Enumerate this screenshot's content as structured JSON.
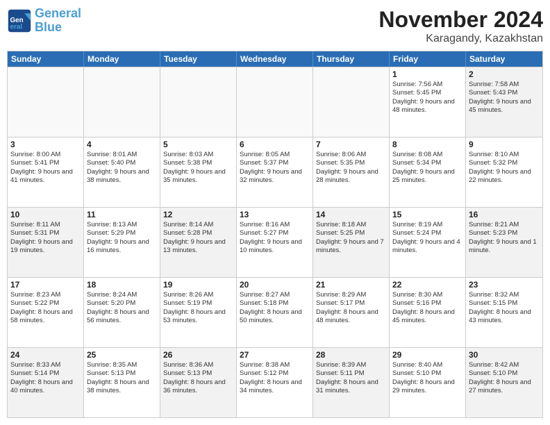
{
  "logo": {
    "line1": "General",
    "line2": "Blue"
  },
  "title": "November 2024",
  "subtitle": "Karagandy, Kazakhstan",
  "days": [
    "Sunday",
    "Monday",
    "Tuesday",
    "Wednesday",
    "Thursday",
    "Friday",
    "Saturday"
  ],
  "rows": [
    [
      {
        "day": "",
        "empty": true
      },
      {
        "day": "",
        "empty": true
      },
      {
        "day": "",
        "empty": true
      },
      {
        "day": "",
        "empty": true
      },
      {
        "day": "",
        "empty": true
      },
      {
        "day": "1",
        "sunrise": "7:56 AM",
        "sunset": "5:45 PM",
        "daylight": "9 hours and 48 minutes."
      },
      {
        "day": "2",
        "sunrise": "7:58 AM",
        "sunset": "5:43 PM",
        "daylight": "9 hours and 45 minutes."
      }
    ],
    [
      {
        "day": "3",
        "sunrise": "8:00 AM",
        "sunset": "5:41 PM",
        "daylight": "9 hours and 41 minutes."
      },
      {
        "day": "4",
        "sunrise": "8:01 AM",
        "sunset": "5:40 PM",
        "daylight": "9 hours and 38 minutes."
      },
      {
        "day": "5",
        "sunrise": "8:03 AM",
        "sunset": "5:38 PM",
        "daylight": "9 hours and 35 minutes."
      },
      {
        "day": "6",
        "sunrise": "8:05 AM",
        "sunset": "5:37 PM",
        "daylight": "9 hours and 32 minutes."
      },
      {
        "day": "7",
        "sunrise": "8:06 AM",
        "sunset": "5:35 PM",
        "daylight": "9 hours and 28 minutes."
      },
      {
        "day": "8",
        "sunrise": "8:08 AM",
        "sunset": "5:34 PM",
        "daylight": "9 hours and 25 minutes."
      },
      {
        "day": "9",
        "sunrise": "8:10 AM",
        "sunset": "5:32 PM",
        "daylight": "9 hours and 22 minutes."
      }
    ],
    [
      {
        "day": "10",
        "sunrise": "8:11 AM",
        "sunset": "5:31 PM",
        "daylight": "9 hours and 19 minutes."
      },
      {
        "day": "11",
        "sunrise": "8:13 AM",
        "sunset": "5:29 PM",
        "daylight": "9 hours and 16 minutes."
      },
      {
        "day": "12",
        "sunrise": "8:14 AM",
        "sunset": "5:28 PM",
        "daylight": "9 hours and 13 minutes."
      },
      {
        "day": "13",
        "sunrise": "8:16 AM",
        "sunset": "5:27 PM",
        "daylight": "9 hours and 10 minutes."
      },
      {
        "day": "14",
        "sunrise": "8:18 AM",
        "sunset": "5:25 PM",
        "daylight": "9 hours and 7 minutes."
      },
      {
        "day": "15",
        "sunrise": "8:19 AM",
        "sunset": "5:24 PM",
        "daylight": "9 hours and 4 minutes."
      },
      {
        "day": "16",
        "sunrise": "8:21 AM",
        "sunset": "5:23 PM",
        "daylight": "9 hours and 1 minute."
      }
    ],
    [
      {
        "day": "17",
        "sunrise": "8:23 AM",
        "sunset": "5:22 PM",
        "daylight": "8 hours and 58 minutes."
      },
      {
        "day": "18",
        "sunrise": "8:24 AM",
        "sunset": "5:20 PM",
        "daylight": "8 hours and 56 minutes."
      },
      {
        "day": "19",
        "sunrise": "8:26 AM",
        "sunset": "5:19 PM",
        "daylight": "8 hours and 53 minutes."
      },
      {
        "day": "20",
        "sunrise": "8:27 AM",
        "sunset": "5:18 PM",
        "daylight": "8 hours and 50 minutes."
      },
      {
        "day": "21",
        "sunrise": "8:29 AM",
        "sunset": "5:17 PM",
        "daylight": "8 hours and 48 minutes."
      },
      {
        "day": "22",
        "sunrise": "8:30 AM",
        "sunset": "5:16 PM",
        "daylight": "8 hours and 45 minutes."
      },
      {
        "day": "23",
        "sunrise": "8:32 AM",
        "sunset": "5:15 PM",
        "daylight": "8 hours and 43 minutes."
      }
    ],
    [
      {
        "day": "24",
        "sunrise": "8:33 AM",
        "sunset": "5:14 PM",
        "daylight": "8 hours and 40 minutes."
      },
      {
        "day": "25",
        "sunrise": "8:35 AM",
        "sunset": "5:13 PM",
        "daylight": "8 hours and 38 minutes."
      },
      {
        "day": "26",
        "sunrise": "8:36 AM",
        "sunset": "5:13 PM",
        "daylight": "8 hours and 36 minutes."
      },
      {
        "day": "27",
        "sunrise": "8:38 AM",
        "sunset": "5:12 PM",
        "daylight": "8 hours and 34 minutes."
      },
      {
        "day": "28",
        "sunrise": "8:39 AM",
        "sunset": "5:11 PM",
        "daylight": "8 hours and 31 minutes."
      },
      {
        "day": "29",
        "sunrise": "8:40 AM",
        "sunset": "5:10 PM",
        "daylight": "8 hours and 29 minutes."
      },
      {
        "day": "30",
        "sunrise": "8:42 AM",
        "sunset": "5:10 PM",
        "daylight": "8 hours and 27 minutes."
      }
    ]
  ]
}
